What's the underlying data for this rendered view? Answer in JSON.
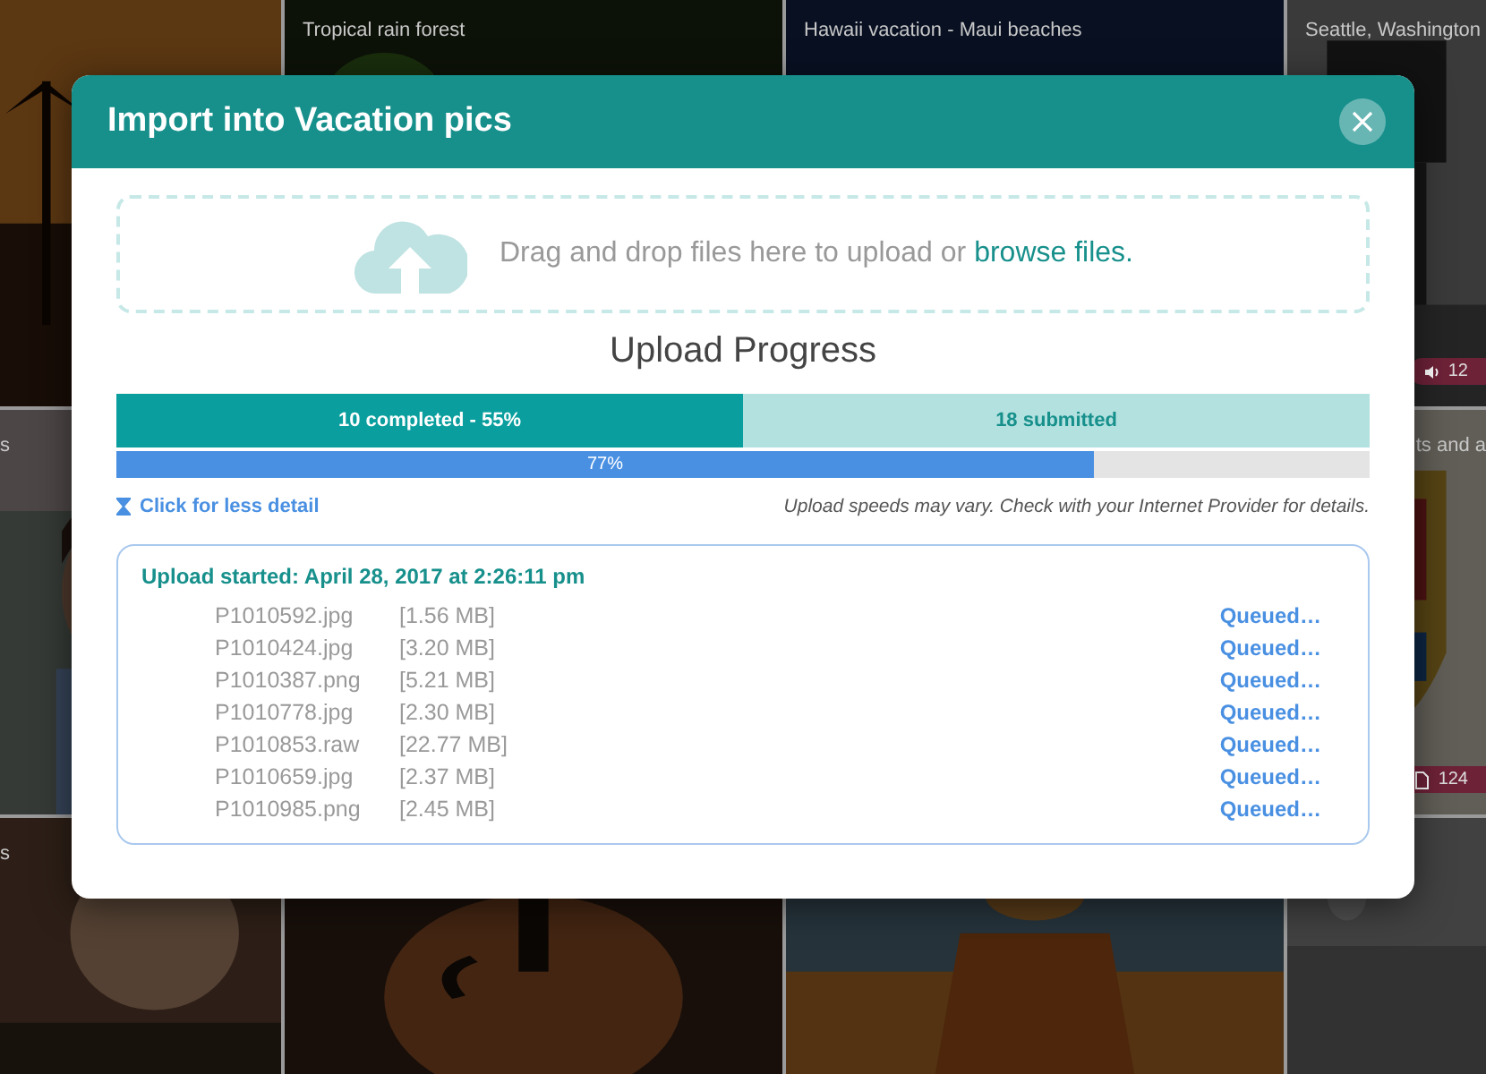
{
  "gallery": {
    "rows": [
      {
        "tiles": [
          {
            "kind": "picture"
          },
          {
            "kind": "picture",
            "caption": "Tropical rain forest"
          },
          {
            "kind": "picture",
            "caption": "Hawaii vacation - Maui beaches"
          },
          {
            "kind": "picture",
            "caption": "Seattle, Washington",
            "badge": {
              "kind": "audio",
              "count": "12"
            }
          }
        ]
      },
      {
        "tiles": [
          {
            "kind": "picture",
            "caption": "s"
          },
          {
            "kind": "picture",
            "caption": "ts and a",
            "badge": {
              "kind": "pages",
              "count": "124"
            }
          }
        ]
      },
      {
        "tiles": [
          {
            "kind": "picture",
            "caption": "s"
          },
          {
            "kind": "picture"
          },
          {
            "kind": "picture"
          },
          {
            "kind": "picture"
          }
        ]
      }
    ]
  },
  "dialog": {
    "title": "Import into Vacation pics",
    "dropzone": {
      "text": "Drag and drop files here to upload or ",
      "link": "browse files."
    },
    "heading": "Upload Progress",
    "file_progress": {
      "level": 0.5,
      "completed": "10 completed - 55%",
      "submitted": "18 submitted"
    },
    "byte_progress": {
      "level": 0.78,
      "label": "77%"
    },
    "detail_link": "Click for less detail",
    "note": "Upload speeds may vary. Check with your Internet Provider for details.",
    "batch": {
      "title": "Upload started: April 28, 2017 at 2:26:11 pm",
      "files": [
        {
          "name": "P1010592.jpg",
          "size": "[1.56 MB]",
          "status": "Queued…"
        },
        {
          "name": "P1010424.jpg",
          "size": "[3.20 MB]",
          "status": "Queued…"
        },
        {
          "name": "P1010387.png",
          "size": "[5.21 MB]",
          "status": "Queued…"
        },
        {
          "name": "P1010778.jpg",
          "size": "[2.30 MB]",
          "status": "Queued…"
        },
        {
          "name": "P1010853.raw",
          "size": "[22.77 MB]",
          "status": "Queued…"
        },
        {
          "name": "P1010659.jpg",
          "size": "[2.37 MB]",
          "status": "Queued…"
        },
        {
          "name": "P1010985.png",
          "size": "[2.45 MB]",
          "status": "Queued…"
        }
      ]
    }
  }
}
